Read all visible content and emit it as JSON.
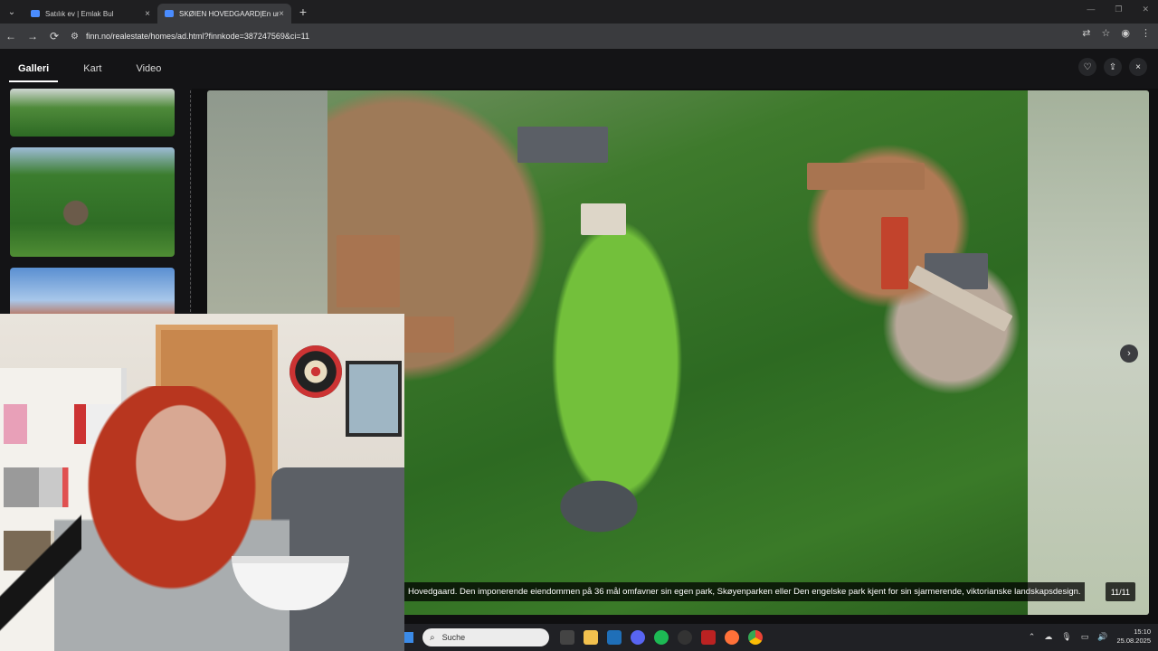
{
  "browser": {
    "tabs": [
      {
        "title": "Satılık ev | Emlak Bul",
        "active": false
      },
      {
        "title": "SKØIEN HOVEDGAARD|En unik",
        "active": true
      }
    ],
    "url": "finn.no/realestate/homes/ad.html?finnkode=387247569&ci=11"
  },
  "gallery": {
    "tabs": [
      "Galleri",
      "Kart",
      "Video"
    ],
    "selected_tab": "Galleri",
    "caption": "Hovedgaard. Den imponerende eiendommen på 36 mål omfavner sin egen park, Skøyenparken eller Den engelske park kjent for sin sjarmerende, viktorianske landskapsdesign.",
    "counter": "11/11"
  },
  "taskbar": {
    "search_placeholder": "Suche",
    "time": "15:10",
    "date": "25.08.2025"
  },
  "icons": {
    "back": "←",
    "forward": "→",
    "reload": "⟳",
    "close": "×",
    "plus": "+",
    "heart": "♡",
    "share": "⇪",
    "chevron_right": "›",
    "search": "⌕",
    "star": "☆",
    "menu": "⋮"
  }
}
